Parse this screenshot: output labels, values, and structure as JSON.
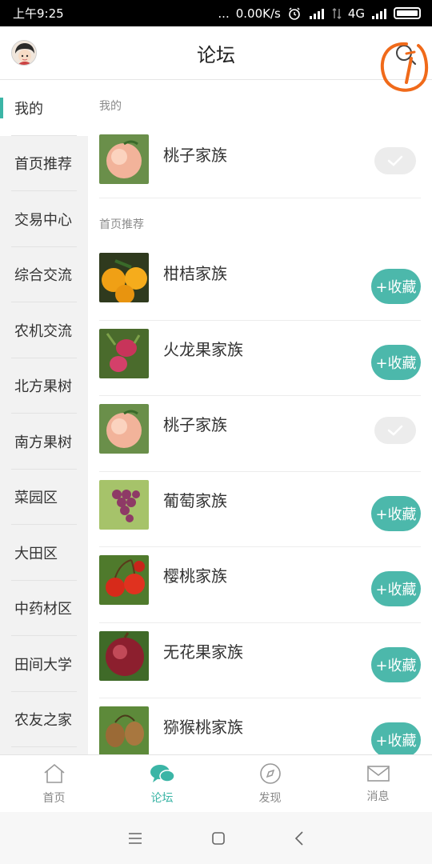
{
  "status_bar": {
    "time": "上午9:25",
    "network_speed": "0.00K/s",
    "network_type": "4G",
    "dots": "..."
  },
  "header": {
    "title": "论坛"
  },
  "sidebar": {
    "items": [
      {
        "label": "我的",
        "active": true
      },
      {
        "label": "首页推荐"
      },
      {
        "label": "交易中心"
      },
      {
        "label": "综合交流"
      },
      {
        "label": "农机交流"
      },
      {
        "label": "北方果树"
      },
      {
        "label": "南方果树"
      },
      {
        "label": "菜园区"
      },
      {
        "label": "大田区"
      },
      {
        "label": "中药材区"
      },
      {
        "label": "田间大学"
      },
      {
        "label": "农友之家"
      }
    ]
  },
  "main": {
    "sections": [
      {
        "label": "我的",
        "rows": [
          {
            "name": "桃子家族",
            "subscribed": true,
            "image": "peach"
          }
        ]
      },
      {
        "label": "首页推荐",
        "rows": [
          {
            "name": "柑桔家族",
            "subscribed": false,
            "action_label": "+收藏",
            "image": "orange"
          },
          {
            "name": "火龙果家族",
            "subscribed": false,
            "action_label": "+收藏",
            "image": "dragonfruit"
          },
          {
            "name": "桃子家族",
            "subscribed": true,
            "image": "peach"
          },
          {
            "name": "葡萄家族",
            "subscribed": false,
            "action_label": "+收藏",
            "image": "grape"
          },
          {
            "name": "樱桃家族",
            "subscribed": false,
            "action_label": "+收藏",
            "image": "cherry"
          },
          {
            "name": "无花果家族",
            "subscribed": false,
            "action_label": "+收藏",
            "image": "fig"
          },
          {
            "name": "猕猴桃家族",
            "subscribed": false,
            "action_label": "+收藏",
            "image": "kiwi"
          }
        ]
      }
    ]
  },
  "bottom_nav": {
    "items": [
      {
        "label": "首页",
        "icon": "home-icon"
      },
      {
        "label": "论坛",
        "icon": "chat-bubbles-icon",
        "active": true
      },
      {
        "label": "发现",
        "icon": "compass-icon"
      },
      {
        "label": "消息",
        "icon": "mail-icon"
      }
    ]
  },
  "colors": {
    "accent": "#3bb5a6",
    "fav_button": "#4cb8ab"
  }
}
